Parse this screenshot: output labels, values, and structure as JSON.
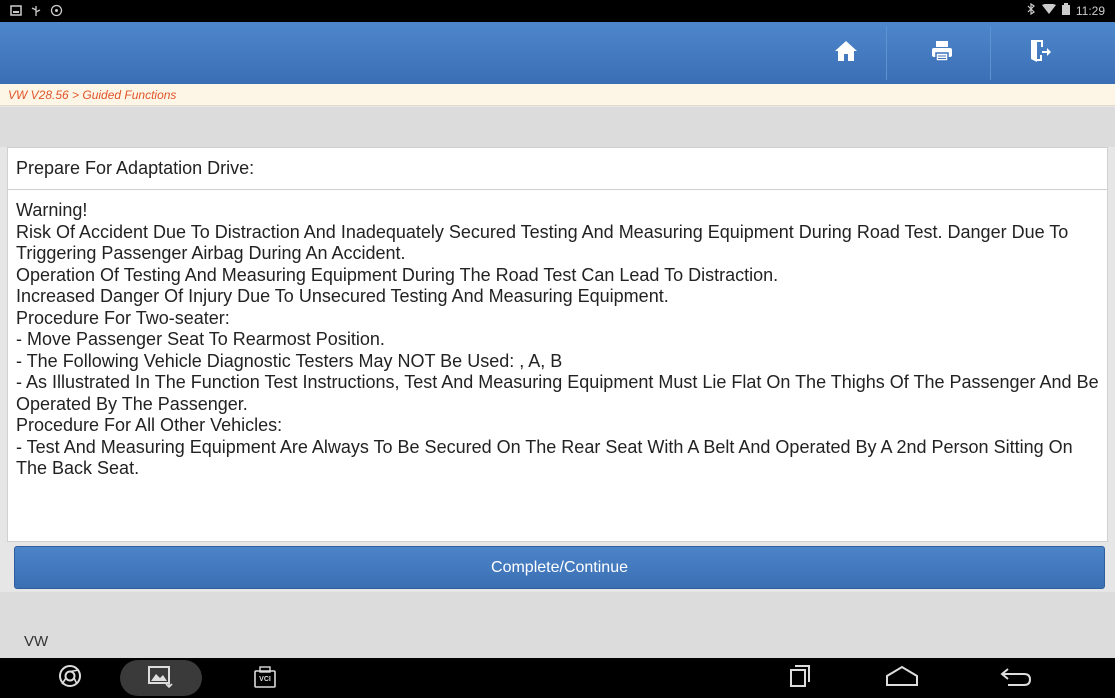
{
  "status_bar": {
    "time": "11:29",
    "left_icons": [
      "screenshot-icon",
      "usb-icon",
      "vpn-icon"
    ],
    "right_icons": [
      "bluetooth-icon",
      "wifi-icon",
      "battery-icon"
    ]
  },
  "header": {
    "buttons": [
      "home-icon",
      "print-icon",
      "exit-icon"
    ],
    "accent": "#3f74bb"
  },
  "breadcrumb": "VW V28.56 > Guided Functions",
  "panel": {
    "title": "Prepare For Adaptation Drive:",
    "lines": [
      "Warning!",
      " Risk Of Accident Due To Distraction And Inadequately Secured Testing And Measuring Equipment During Road Test. Danger Due To Triggering Passenger Airbag During An Accident.",
      " Operation Of Testing And Measuring Equipment During The Road Test Can Lead To Distraction.",
      " Increased Danger Of Injury Due To Unsecured Testing And Measuring Equipment.",
      " Procedure For Two-seater:",
      " - Move Passenger Seat To Rearmost Position.",
      "- The Following Vehicle Diagnostic Testers May NOT Be Used: , A, B",
      "- As Illustrated In The Function Test Instructions, Test And Measuring Equipment Must Lie Flat On The Thighs Of The Passenger And Be Operated By The Passenger.",
      " Procedure For All Other Vehicles:",
      " - Test And Measuring Equipment Are Always To Be Secured On The Rear Seat With A Belt And Operated By A 2nd Person Sitting On The Back Seat."
    ]
  },
  "action_button": "Complete/Continue",
  "footer_label": "VW",
  "nav_bar": {
    "vci_label": "VCI",
    "icons": [
      "browser-icon",
      "gallery-icon",
      "vci-icon",
      "recents-icon",
      "home-nav-icon",
      "back-icon"
    ]
  }
}
